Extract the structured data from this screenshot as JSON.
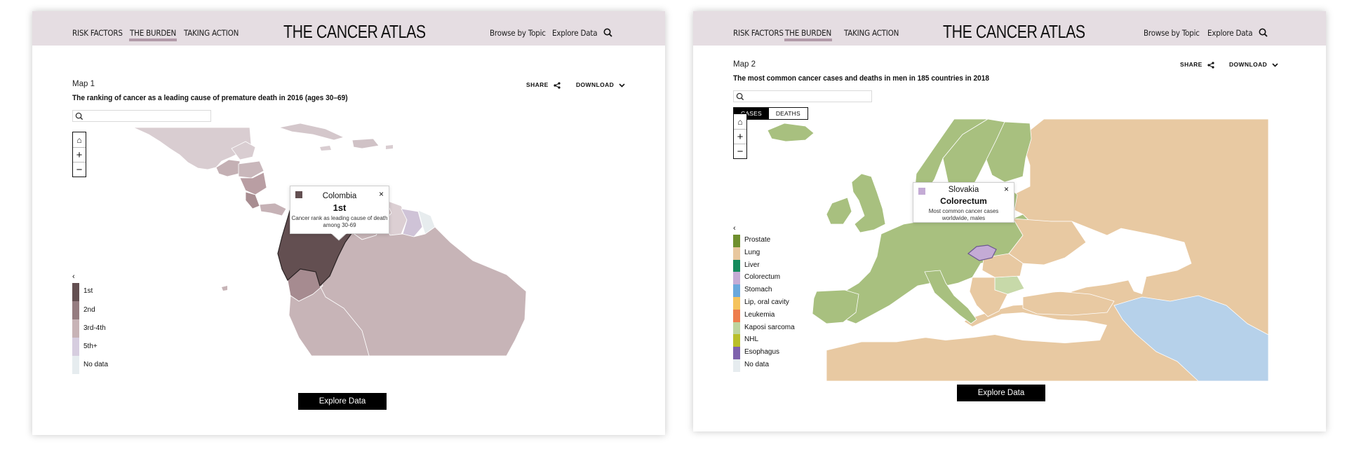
{
  "colors": {
    "header_bg": "#e5dde2",
    "nav_active_bar": "#b19aa8",
    "rank_1st": "#634f51",
    "rank_2nd": "#957c80",
    "rank_3rd_4th": "#c7b3b6",
    "rank_5th_plus": "#d6cddf",
    "no_data": "#e6ecef",
    "prostate": "#6f8f2e",
    "lung": "#e8c79e",
    "liver": "#158a5c",
    "colorectum": "#c4abd5",
    "stomach": "#6aa8dc",
    "lip_oral": "#f5c35c",
    "leukemia": "#ee7d4d",
    "kaposi": "#bdd49e",
    "nhl": "#b9bf2a",
    "esophagus": "#7e62ad"
  },
  "left": {
    "nav": [
      "RISK FACTORS",
      "THE BURDEN",
      "TAKING ACTION"
    ],
    "brand": "THE CANCER ATLAS",
    "links": [
      "Browse by Topic",
      "Explore Data"
    ],
    "map_number": "Map 1",
    "map_title": "The ranking of cancer as a leading cause of premature death in 2016 (ages 30–69)",
    "share": "SHARE",
    "download": "DOWNLOAD",
    "search_placeholder": "",
    "zoom": {
      "home": "⌂",
      "in": "+",
      "out": "−"
    },
    "legend_collapse": "‹",
    "legend": [
      "1st",
      "2nd",
      "3rd-4th",
      "5th+",
      "No data"
    ],
    "tooltip": {
      "country": "Colombia",
      "value": "1st",
      "desc1": "Cancer rank as leading cause of death",
      "desc2": "among 30-69",
      "close": "×"
    },
    "explore_button": "Explore Data"
  },
  "right": {
    "nav": [
      "RISK FACTORS",
      "THE BURDEN",
      "TAKING ACTION"
    ],
    "brand": "THE CANCER ATLAS",
    "links": [
      "Browse by Topic",
      "Explore Data"
    ],
    "map_number": "Map 2",
    "map_title": "The most common cancer cases and deaths in men in 185 countries in 2018",
    "share": "SHARE",
    "download": "DOWNLOAD",
    "search_placeholder": "",
    "tabs": [
      "CASES",
      "DEATHS"
    ],
    "zoom": {
      "home": "⌂",
      "in": "+",
      "out": "−"
    },
    "legend_collapse": "‹",
    "legend": [
      "Prostate",
      "Lung",
      "Liver",
      "Colorectum",
      "Stomach",
      "Lip, oral cavity",
      "Leukemia",
      "Kaposi sarcoma",
      "NHL",
      "Esophagus",
      "No data"
    ],
    "tooltip": {
      "country": "Slovakia",
      "value": "Colorectum",
      "desc1": "Most common cancer cases",
      "desc2": "worldwide, males",
      "close": "×"
    },
    "explore_button": "Explore Data"
  }
}
